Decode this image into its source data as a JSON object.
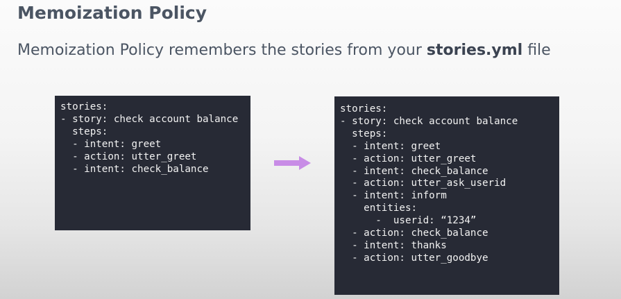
{
  "title": "Memoization Policy",
  "subtitle": {
    "prefix": "Memoization Policy remembers the stories from your ",
    "bold": "stories.yml",
    "suffix": " file"
  },
  "left_code": [
    "stories:",
    "- story: check account balance",
    "  steps:",
    "  - intent: greet",
    "  - action: utter_greet",
    "  - intent: check_balance"
  ],
  "right_code": [
    "stories:",
    "- story: check account balance",
    "  steps:",
    "  - intent: greet",
    "  - action: utter_greet",
    "  - intent: check_balance",
    "  - action: utter_ask_userid",
    "  - intent: inform",
    "    entities:",
    "      -  userid: “1234”",
    "  - action: check_balance",
    "  - intent: thanks",
    "  - action: utter_goodbye"
  ],
  "colors": {
    "code_background": "#272a35",
    "code_text": "#f2f2f2",
    "arrow": "#c88ce6",
    "heading_text": "#4b5563"
  },
  "icons": {
    "arrow": "right-arrow-icon"
  }
}
